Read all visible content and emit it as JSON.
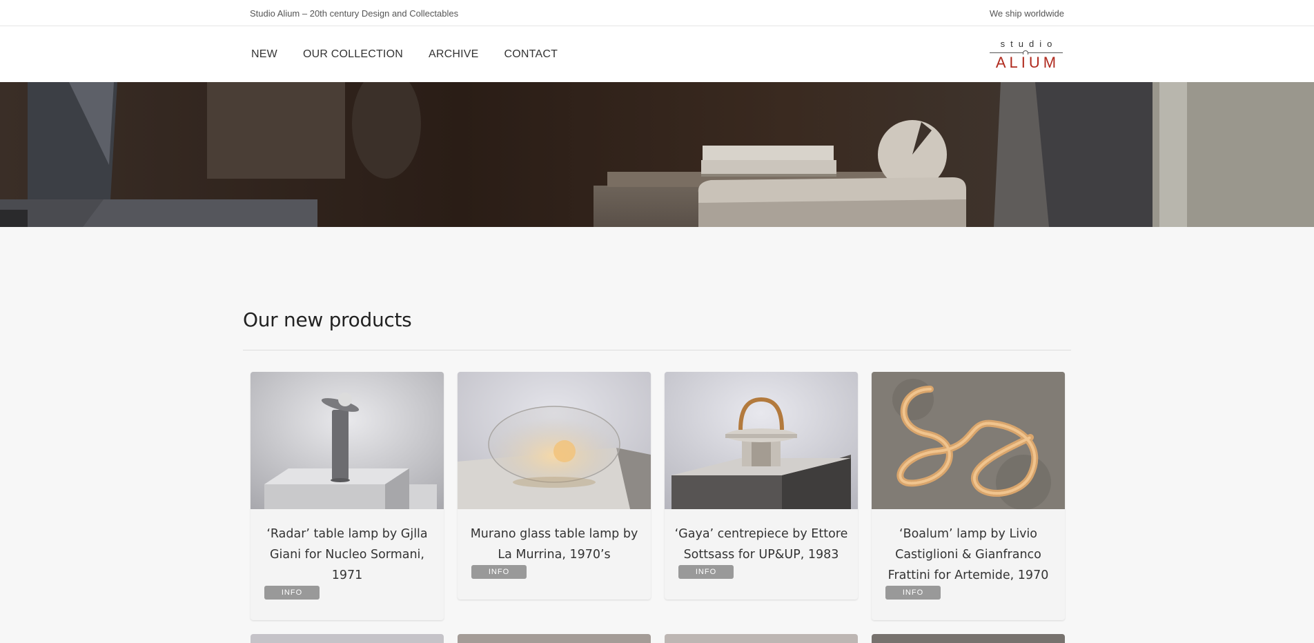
{
  "topbar": {
    "tagline": "Studio Alium – 20th century Design and Collectables",
    "shipping": "We ship worldwide"
  },
  "nav": {
    "items": [
      {
        "label": "NEW"
      },
      {
        "label": "OUR COLLECTION"
      },
      {
        "label": "ARCHIVE"
      },
      {
        "label": "CONTACT"
      }
    ]
  },
  "logo": {
    "top_text": "studio",
    "bottom_text": "ALIUM",
    "accent_color": "#b02a1e"
  },
  "section": {
    "title": "Our new products"
  },
  "products": [
    {
      "title": "‘Radar’ table lamp by Gjlla Giani for Nucleo Sormani, 1971",
      "button": "INFO"
    },
    {
      "title": "Murano glass table lamp by La Murrina, 1970’s",
      "button": "INFO"
    },
    {
      "title": "‘Gaya’ centrepiece by Ettore Sottsass for UP&UP, 1983",
      "button": "INFO"
    },
    {
      "title": "‘Boalum’ lamp by Livio Castiglioni & Gianfranco Frattini for Artemide, 1970",
      "button": "INFO"
    }
  ]
}
